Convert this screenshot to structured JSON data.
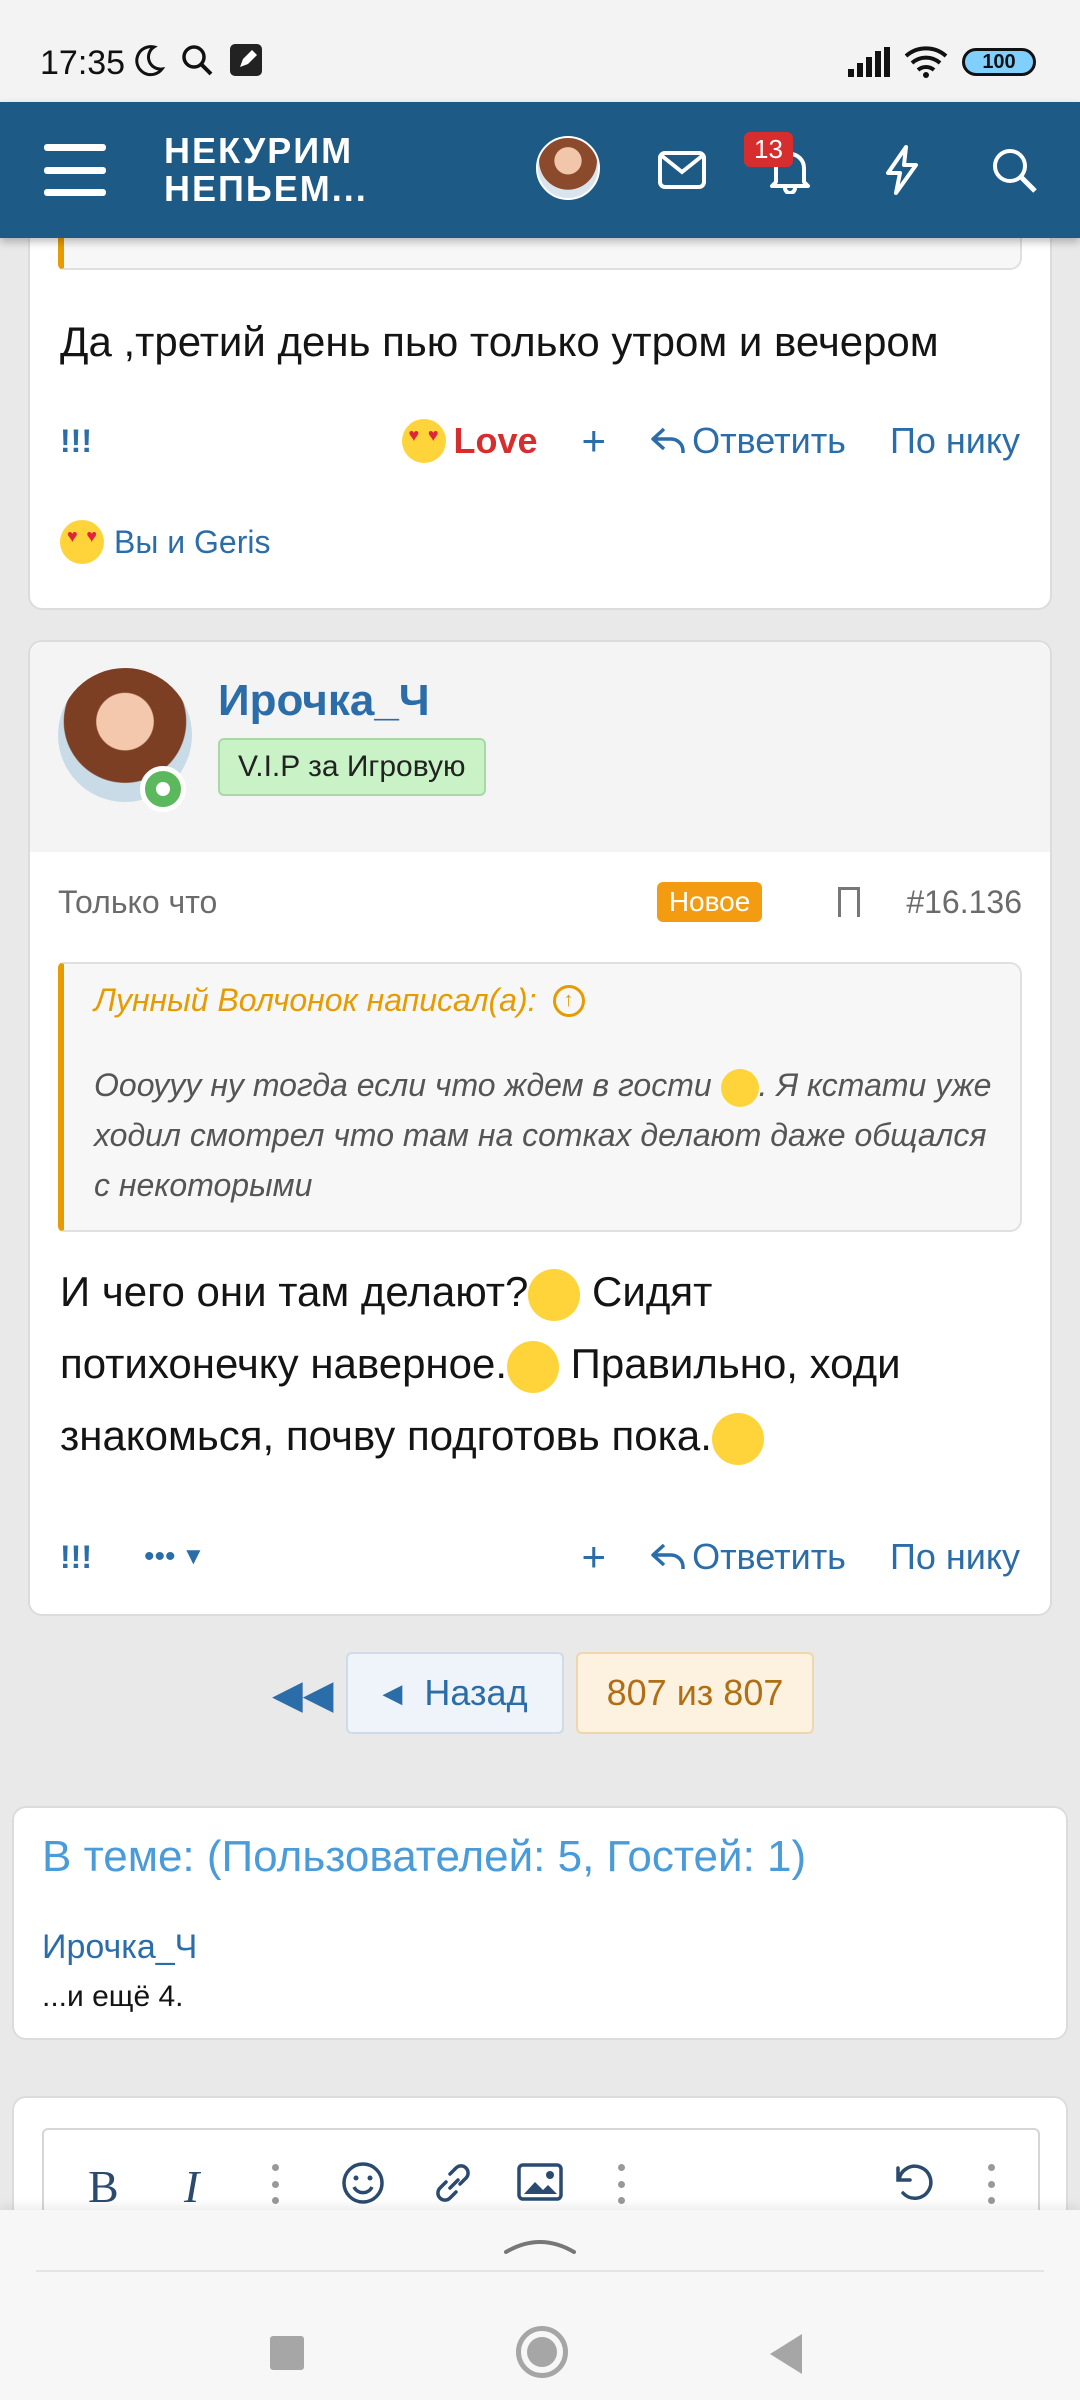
{
  "status_bar": {
    "time": "17:35",
    "battery": "100"
  },
  "header": {
    "logo_line1": "НЕКУРИМ",
    "logo_line2": "НЕПЬЕМ...",
    "notification_count": "13"
  },
  "post1": {
    "text": "Да ,третий день пью только утром и вечером",
    "actions": {
      "exclaim": "!!!",
      "love": "Love",
      "plus": "+",
      "reply": "Ответить",
      "by_nick": "По нику"
    },
    "reactions_text": "Вы и Geris"
  },
  "post2": {
    "username": "Ирочка_Ч",
    "user_title": "V.I.P за Игровую",
    "time": "Только что",
    "new_badge": "Новое",
    "post_number": "#16.136",
    "quote": {
      "author": "Лунный Волчонок написал(а):",
      "text_part1": "Оооууу ну тогда если что ждем в гости ",
      "text_part2": ". Я кстати уже ходил смотрел что там на сотках делают даже общался с некоторыми"
    },
    "text_line1": "И чего они там делают?",
    "text_line1b": " Сидят",
    "text_line2": "потихонечку наверное.",
    "text_line2b": " Правильно, ходи",
    "text_line3": "знакомься, почву подготовь пока.",
    "actions": {
      "exclaim": "!!!",
      "more": "•••",
      "plus": "+",
      "reply": "Ответить",
      "by_nick": "По нику"
    }
  },
  "pager": {
    "back": "Назад",
    "current": "807 из 807"
  },
  "online": {
    "title": "В теме: (Пользователей: 5, Гостей: 1)",
    "user": "Ирочка_Ч",
    "more": "...и ещё 4."
  },
  "editor": {
    "bold": "B",
    "italic": "I"
  },
  "colors": {
    "header": "#1e5a86",
    "link": "#2b6da8",
    "quote_accent": "#e69b00",
    "new_badge": "#f39c12"
  }
}
